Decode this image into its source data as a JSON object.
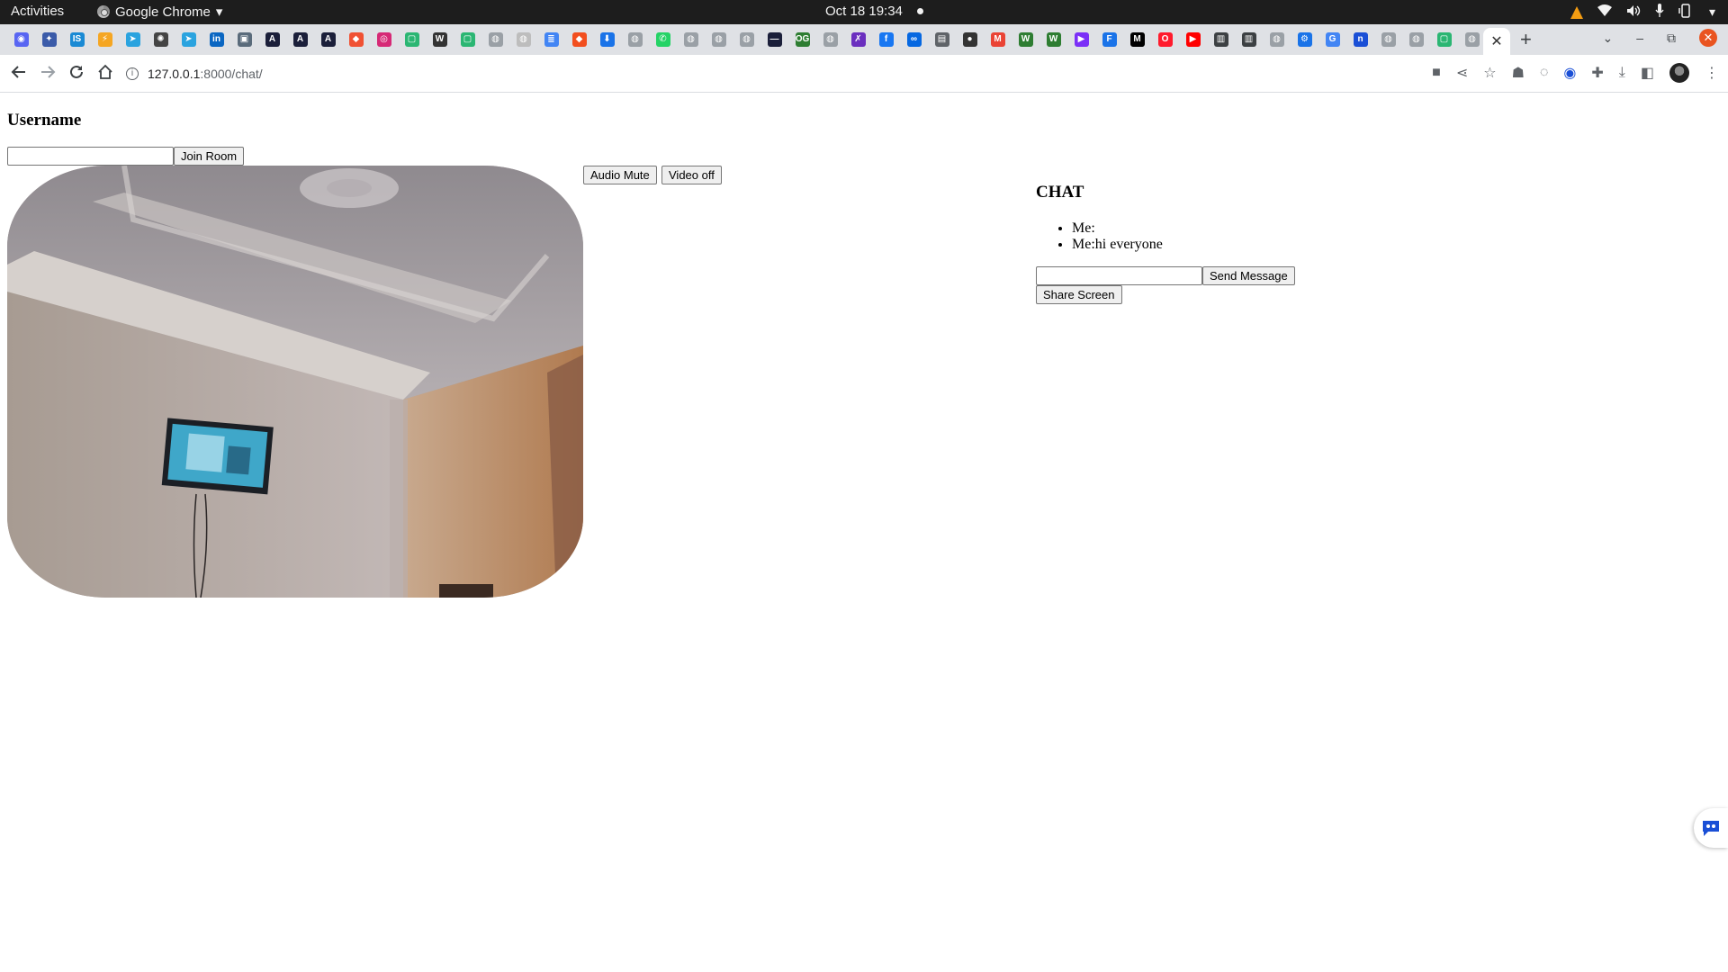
{
  "topbar": {
    "activities": "Activities",
    "app_name": "Google Chrome",
    "app_menu_arrow": "▾",
    "clock": "Oct 18  19:34"
  },
  "tabstrip": {
    "favicons": [
      {
        "icon": "discord-icon",
        "color": "#5865f2",
        "glyph": "◉"
      },
      {
        "icon": "sparkle-icon",
        "color": "#3b5ba9",
        "glyph": "✦"
      },
      {
        "icon": "is-icon",
        "color": "#1a8ad4",
        "glyph": "IS"
      },
      {
        "icon": "bolt-icon",
        "color": "#f5a623",
        "glyph": "⚡"
      },
      {
        "icon": "telegram-icon",
        "color": "#2aa3df",
        "glyph": "➤"
      },
      {
        "icon": "openai-icon",
        "color": "#444444",
        "glyph": "✺"
      },
      {
        "icon": "telegram-icon",
        "color": "#2aa3df",
        "glyph": "➤"
      },
      {
        "icon": "linkedin-icon",
        "color": "#0a66c2",
        "glyph": "in"
      },
      {
        "icon": "car-icon",
        "color": "#5a6b7b",
        "glyph": "▣"
      },
      {
        "icon": "appwrite-icon",
        "color": "#1b1f3a",
        "glyph": "A"
      },
      {
        "icon": "appwrite-icon",
        "color": "#1b1f3a",
        "glyph": "A"
      },
      {
        "icon": "appwrite-icon",
        "color": "#1b1f3a",
        "glyph": "A"
      },
      {
        "icon": "git-icon",
        "color": "#f05133",
        "glyph": "⬥"
      },
      {
        "icon": "instagram-icon",
        "color": "#d62976",
        "glyph": "◎"
      },
      {
        "icon": "screen-icon",
        "color": "#2bb673",
        "glyph": "▢"
      },
      {
        "icon": "wikipedia-icon",
        "color": "#333333",
        "glyph": "W"
      },
      {
        "icon": "screen-icon",
        "color": "#2bb673",
        "glyph": "▢"
      },
      {
        "icon": "globe-icon",
        "color": "#9aa0a6",
        "glyph": "◍"
      },
      {
        "icon": "globe-icon",
        "color": "#bdbdbd",
        "glyph": "◍"
      },
      {
        "icon": "docs-icon",
        "color": "#4285f4",
        "glyph": "≣"
      },
      {
        "icon": "figma-icon",
        "color": "#f24e1e",
        "glyph": "◆"
      },
      {
        "icon": "download-icon",
        "color": "#1a73e8",
        "glyph": "⬇"
      },
      {
        "icon": "globe-icon",
        "color": "#9aa0a6",
        "glyph": "◍"
      },
      {
        "icon": "whatsapp-icon",
        "color": "#25d366",
        "glyph": "✆"
      },
      {
        "icon": "globe-icon",
        "color": "#9aa0a6",
        "glyph": "◍"
      },
      {
        "icon": "globe-icon",
        "color": "#9aa0a6",
        "glyph": "◍"
      },
      {
        "icon": "globe-icon",
        "color": "#9aa0a6",
        "glyph": "◍"
      },
      {
        "icon": "dash-icon",
        "color": "#1b1f3a",
        "glyph": "—"
      },
      {
        "icon": "og-icon",
        "color": "#2e7d32",
        "glyph": "OG"
      },
      {
        "icon": "globe-icon",
        "color": "#9aa0a6",
        "glyph": "◍"
      },
      {
        "icon": "purple-icon",
        "color": "#6b2fbf",
        "glyph": "✗"
      },
      {
        "icon": "facebook-icon",
        "color": "#1877f2",
        "glyph": "f"
      },
      {
        "icon": "meta-icon",
        "color": "#0668e1",
        "glyph": "∞"
      },
      {
        "icon": "printer-icon",
        "color": "#5f6368",
        "glyph": "▤"
      },
      {
        "icon": "github-icon",
        "color": "#333333",
        "glyph": "●"
      },
      {
        "icon": "gmail-icon",
        "color": "#ea4335",
        "glyph": "M"
      },
      {
        "icon": "webflow-icon",
        "color": "#2e7d32",
        "glyph": "W"
      },
      {
        "icon": "webflow-icon",
        "color": "#2e7d32",
        "glyph": "W"
      },
      {
        "icon": "play-icon",
        "color": "#7b2ff7",
        "glyph": "▶"
      },
      {
        "icon": "forms-icon",
        "color": "#1a73e8",
        "glyph": "F"
      },
      {
        "icon": "medium-icon",
        "color": "#000000",
        "glyph": "M"
      },
      {
        "icon": "opera-icon",
        "color": "#ff1b2d",
        "glyph": "O"
      },
      {
        "icon": "youtube-icon",
        "color": "#ff0000",
        "glyph": "▶"
      },
      {
        "icon": "book-icon",
        "color": "#3c4043",
        "glyph": "▥"
      },
      {
        "icon": "book-icon",
        "color": "#3c4043",
        "glyph": "▥"
      },
      {
        "icon": "globe-icon",
        "color": "#9aa0a6",
        "glyph": "◍"
      },
      {
        "icon": "gear-icon",
        "color": "#1a73e8",
        "glyph": "⚙"
      },
      {
        "icon": "google-icon",
        "color": "#4285f4",
        "glyph": "G"
      },
      {
        "icon": "notion-icon",
        "color": "#1a4fd6",
        "glyph": "n"
      },
      {
        "icon": "globe-icon",
        "color": "#9aa0a6",
        "glyph": "◍"
      },
      {
        "icon": "globe-icon",
        "color": "#9aa0a6",
        "glyph": "◍"
      },
      {
        "icon": "screen-icon",
        "color": "#2bb673",
        "glyph": "▢"
      },
      {
        "icon": "globe-icon",
        "color": "#9aa0a6",
        "glyph": "◍"
      }
    ],
    "active_tab_close": "✕",
    "new_tab": "+"
  },
  "toolbar": {
    "url_host": "127.0.0.1",
    "url_path": ":8000/chat/"
  },
  "page": {
    "username_heading": "Username",
    "username_input_value": "",
    "join_button": "Join Room",
    "audio_button": "Audio Mute",
    "video_button": "Video off",
    "chat_heading": "CHAT",
    "messages": [
      "Me:",
      "Me:hi everyone"
    ],
    "message_input_value": "",
    "send_button": "Send Message",
    "share_button": "Share Screen"
  }
}
